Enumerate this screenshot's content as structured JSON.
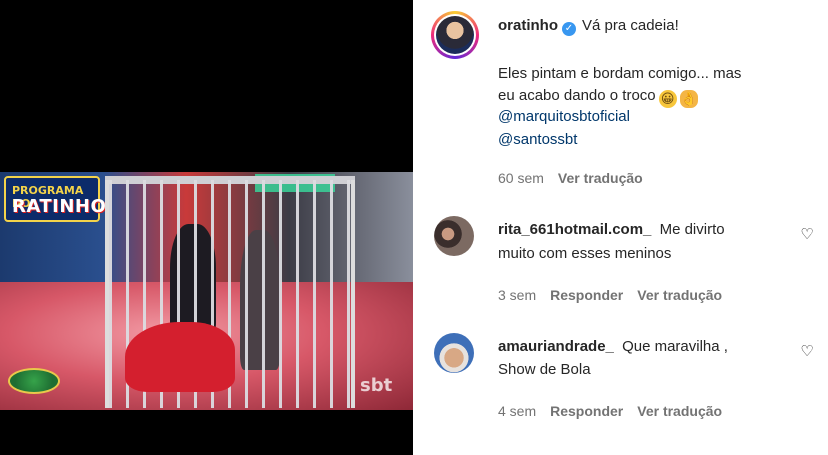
{
  "video": {
    "show_logo_top": "PROGRAMA DO",
    "show_logo_name": "RATINHO",
    "watermark": "sbt"
  },
  "post": {
    "author": "oratinho",
    "caption_first": "Vá pra cadeia!",
    "caption_line2": "Eles pintam e bordam comigo... mas",
    "caption_line3": "eu acabo dando o troco",
    "emoji_1": "😀",
    "emoji_2": "👌",
    "mention_1": "@marquitosbtoficial",
    "mention_2": "@santossbt",
    "time": "60 sem",
    "see_translation": "Ver tradução"
  },
  "comments": [
    {
      "username": "rita_661hotmail.com_",
      "text_line1": "Me divirto",
      "text_line2": "muito com esses meninos",
      "time": "3 sem",
      "reply": "Responder",
      "see_translation": "Ver tradução"
    },
    {
      "username": "amauriandrade_",
      "text_line1": "Que maravilha ,",
      "text_line2": "Show de Bola",
      "time": "4 sem",
      "reply": "Responder",
      "see_translation": "Ver tradução"
    }
  ],
  "icons": {
    "verified": "verified-badge-icon",
    "like": "heart-icon"
  },
  "colors": {
    "link": "#00376b",
    "meta": "#737373",
    "verified": "#3897f0"
  }
}
